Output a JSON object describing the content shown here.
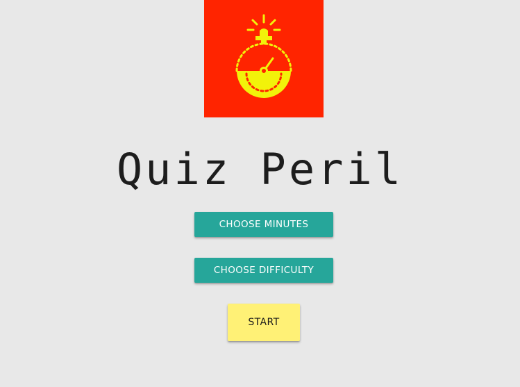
{
  "app": {
    "title": "Quiz Peril",
    "logo_icon": "alarm-stopwatch-icon",
    "colors": {
      "background": "#e8e8e8",
      "logo_background": "#ff2400",
      "logo_foreground": "#f2f20a",
      "primary_button": "#26a69a",
      "start_button": "#fff176"
    }
  },
  "menu": {
    "choose_minutes_label": "CHOOSE MINUTES",
    "choose_difficulty_label": "CHOOSE DIFFICULTY",
    "start_label": "START"
  }
}
